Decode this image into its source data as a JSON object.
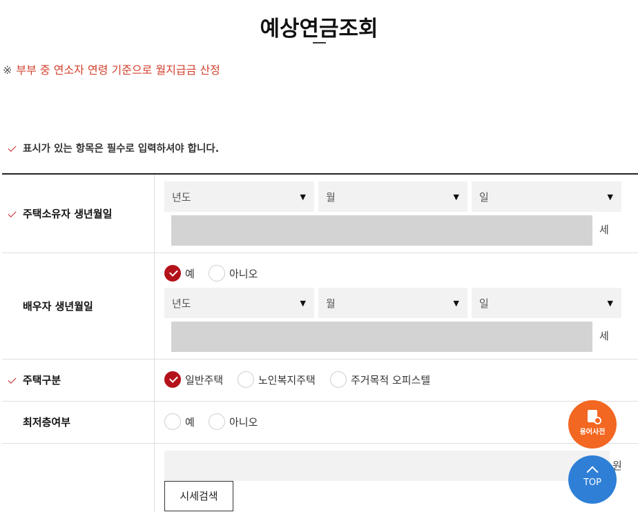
{
  "page": {
    "title": "예상연금조회"
  },
  "notice": {
    "mark": "※",
    "text": "부부 중 연소자 연령 기준으로 월지급금 산정"
  },
  "required_note": "표시가 있는 항목은 필수로 입력하셔야 합니다.",
  "owner_birth": {
    "label": "주택소유자 생년월일",
    "year_placeholder": "년도",
    "month_placeholder": "월",
    "day_placeholder": "일",
    "age_unit": "세"
  },
  "spouse_birth": {
    "label": "배우자 생년월일",
    "options": [
      "예",
      "아니오"
    ],
    "selected": "예",
    "year_placeholder": "년도",
    "month_placeholder": "월",
    "day_placeholder": "일",
    "age_unit": "세"
  },
  "house_type": {
    "label": "주택구분",
    "options": [
      "일반주택",
      "노인복지주택",
      "주거목적 오피스텔"
    ],
    "selected": "일반주택"
  },
  "lowest_floor": {
    "label": "최저층여부",
    "options": [
      "예",
      "아니오"
    ],
    "selected": ""
  },
  "price": {
    "unit": "원",
    "search_button": "시세검색"
  },
  "floating": {
    "dictionary_label": "용어사전",
    "top_label": "TOP"
  },
  "icons": {
    "dropdown": "▼"
  },
  "colors": {
    "accent_red": "#b4121b",
    "notice_red": "#d2402c",
    "fab_orange": "#f26722",
    "fab_blue": "#2f7fd6"
  }
}
